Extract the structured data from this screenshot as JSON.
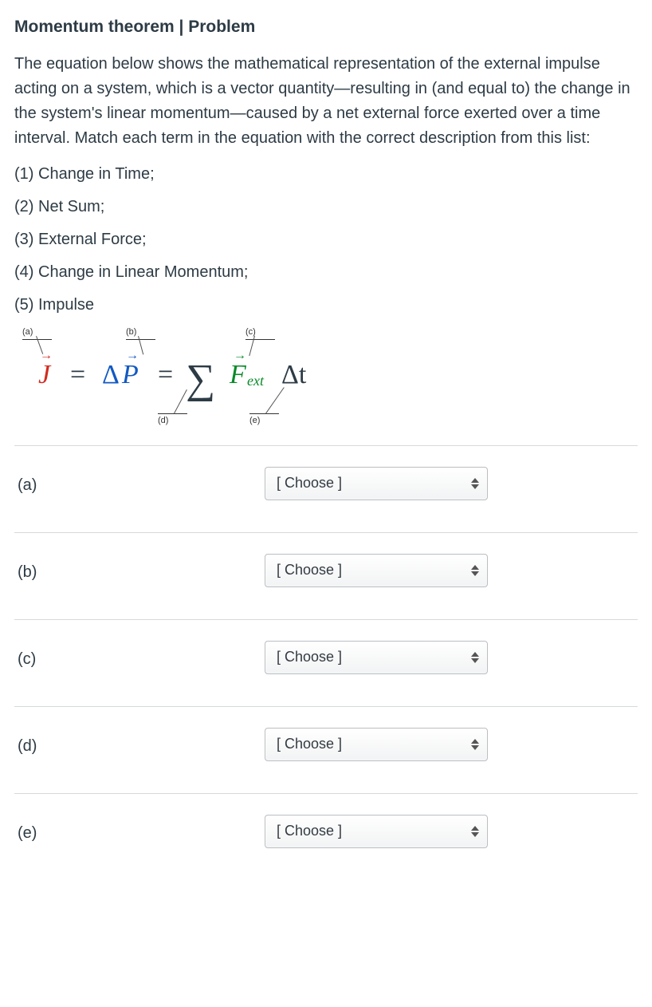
{
  "title": "Momentum theorem  |  Problem",
  "prompt": "The equation below shows the mathematical representation of the external impulse acting on a system, which is a vector quantity—resulting in (and equal to) the change in the system's linear momentum—caused by a net external force exerted over a time interval.  Match each term in the equation with the correct description from this list:",
  "list": [
    "(1) Change in Time;",
    "(2) Net Sum;",
    "(3) External Force;",
    "(4) Change in Linear Momentum;",
    "(5) Impulse"
  ],
  "equation": {
    "labels": {
      "a": "(a)",
      "b": "(b)",
      "c": "(c)",
      "d": "(d)",
      "e": "(e)"
    },
    "terms": {
      "J": "J",
      "eq1": "=",
      "delta": "Δ",
      "P": "P",
      "eq2": "=",
      "sigma": "∑",
      "F": "F",
      "ext": "ext",
      "dt": "Δt",
      "arrow": "→"
    },
    "colors": {
      "J": "#d12b1f",
      "dP": "#1259c3",
      "F": "#0a8a2a"
    }
  },
  "rows": [
    {
      "label": "(a)",
      "placeholder": "[ Choose ]"
    },
    {
      "label": "(b)",
      "placeholder": "[ Choose ]"
    },
    {
      "label": "(c)",
      "placeholder": "[ Choose ]"
    },
    {
      "label": "(d)",
      "placeholder": "[ Choose ]"
    },
    {
      "label": "(e)",
      "placeholder": "[ Choose ]"
    }
  ]
}
